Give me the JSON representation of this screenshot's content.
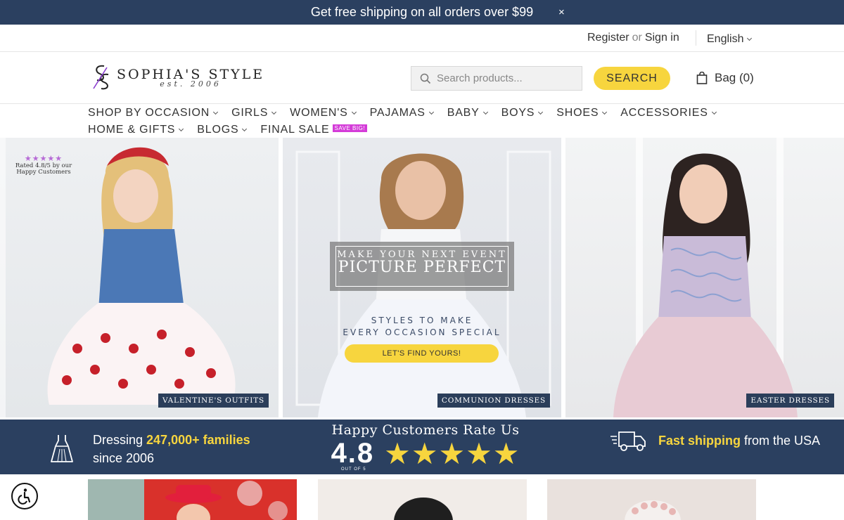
{
  "announcement": {
    "text": "Get free shipping on all orders over $99",
    "close": "×"
  },
  "utility": {
    "register": "Register",
    "or": "or",
    "signin": "Sign in",
    "language": "English"
  },
  "brand": {
    "name": "SOPHIA'S STYLE",
    "est": "est. 2006"
  },
  "search": {
    "placeholder": "Search products...",
    "button": "SEARCH"
  },
  "bag": {
    "label": "Bag",
    "count": "(0)"
  },
  "nav": {
    "row1": [
      "SHOP BY OCCASION",
      "GIRLS",
      "WOMEN'S",
      "PAJAMAS",
      "BABY",
      "BOYS",
      "SHOES",
      "ACCESSORIES"
    ],
    "row2": [
      "HOME & GIFTS",
      "BLOGS",
      "FINAL SALE"
    ],
    "sale_badge": "SAVE BIG!"
  },
  "hero": {
    "tile1": {
      "label": "VALENTINE'S OUTFITS",
      "rating_stars": "★★★★★",
      "rating_text": "Rated 4.8/5 by our Happy Customers"
    },
    "tile2": {
      "headline_small": "MAKE YOUR NEXT EVENT",
      "headline_big": "PICTURE PERFECT",
      "sub1": "STYLES TO MAKE",
      "sub2": "EVERY OCCASION SPECIAL",
      "button": "LET'S FIND YOURS!",
      "label": "COMMUNION DRESSES"
    },
    "tile3": {
      "label": "EASTER DRESSES"
    }
  },
  "trust": {
    "left_pre": "Dressing ",
    "left_bold": "247,000+ families",
    "left_post": "since 2006",
    "mid_title": "Happy Customers Rate Us",
    "mid_rating": "4.8",
    "mid_stars": "★★★★★",
    "mid_outof": "OUT OF 5",
    "right_bold": "Fast shipping",
    "right_post": " from the USA"
  },
  "colors": {
    "navy": "#2b4060",
    "yellow": "#f7d53e",
    "sale": "#d43bd8"
  }
}
